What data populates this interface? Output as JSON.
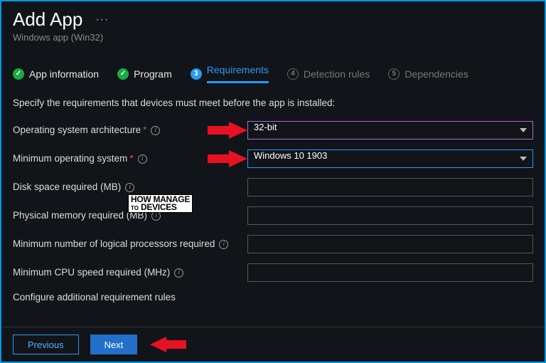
{
  "header": {
    "title": "Add App",
    "subtitle": "Windows app (Win32)"
  },
  "steps": {
    "s1": "App information",
    "s2": "Program",
    "s3": "Requirements",
    "s4": "Detection rules",
    "s5": "Dependencies",
    "n3": "3",
    "n4": "4",
    "n5": "5",
    "check": "✓"
  },
  "instruction": "Specify the requirements that devices must meet before the app is installed:",
  "labels": {
    "arch": "Operating system architecture",
    "minos": "Minimum operating system",
    "disk": "Disk space required (MB)",
    "mem": "Physical memory required (MB)",
    "cpu_count": "Minimum number of logical processors required",
    "cpu_speed": "Minimum CPU speed required (MHz)"
  },
  "values": {
    "arch": "32-bit",
    "minos": "Windows 10 1903",
    "disk": "",
    "mem": "",
    "cpu_count": "",
    "cpu_speed": ""
  },
  "config_text": "Configure additional requirement rules",
  "buttons": {
    "previous": "Previous",
    "next": "Next"
  },
  "watermark": {
    "l1": "HOW",
    "l2": "TO",
    "l3": "MANAGE",
    "l4": "DEVICES"
  }
}
